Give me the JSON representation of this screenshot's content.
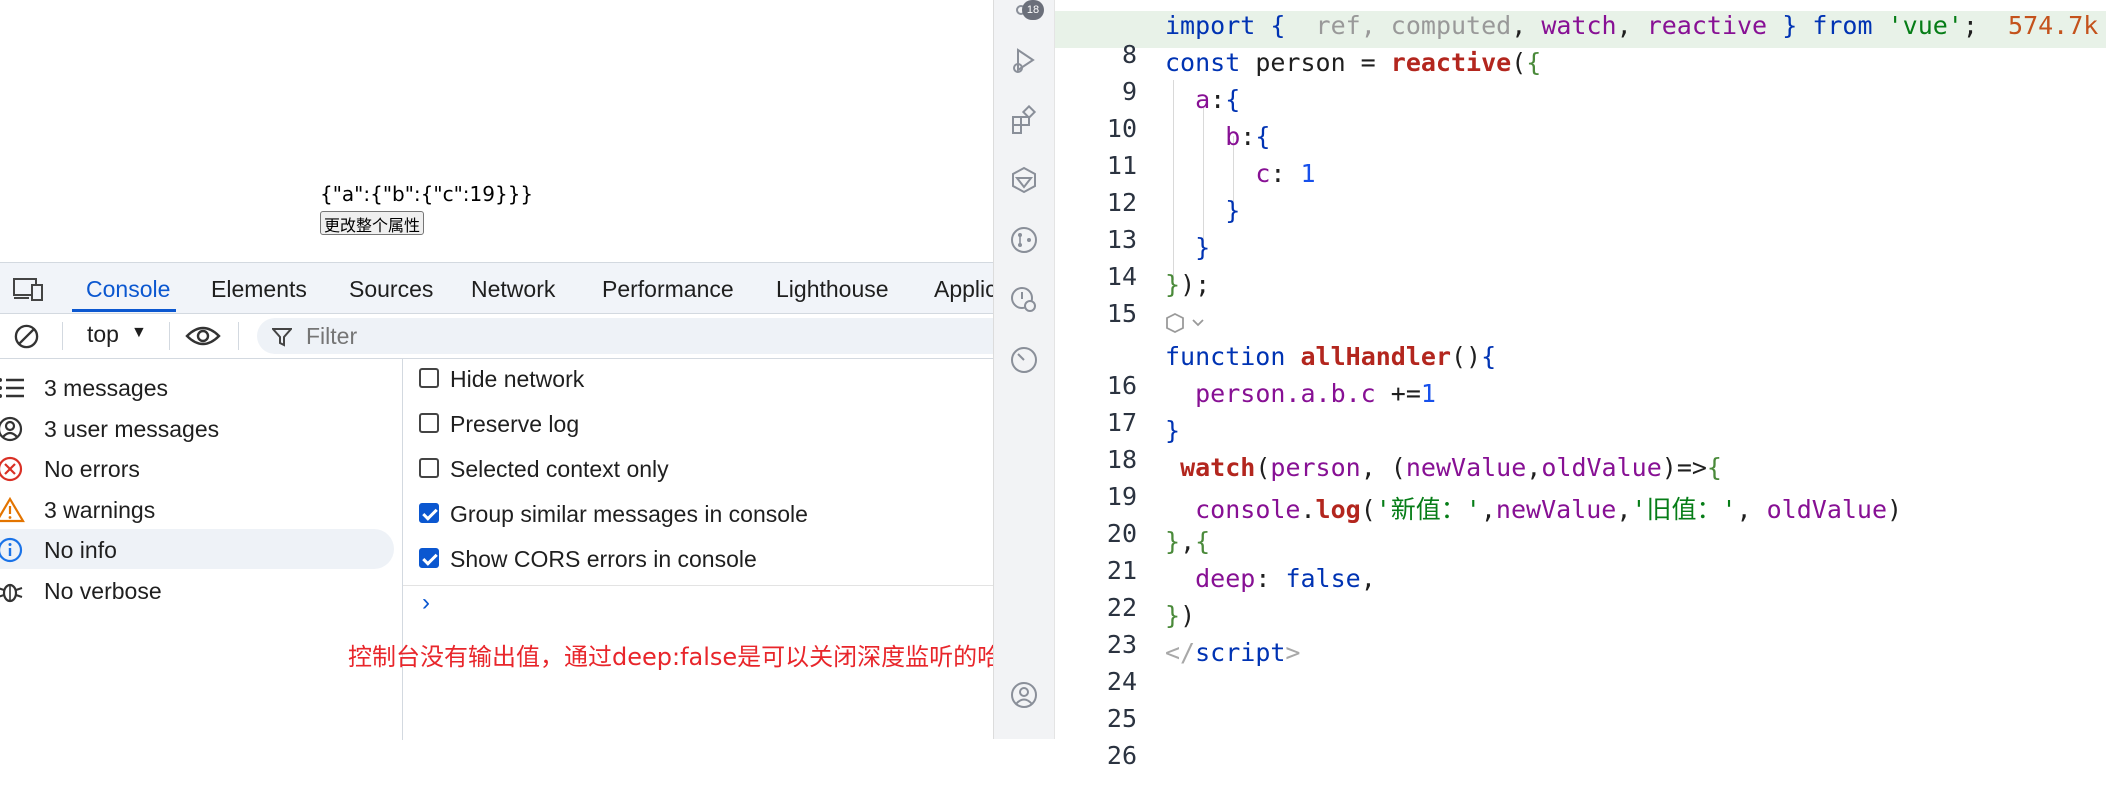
{
  "page": {
    "json_output": "{\"a\":{\"b\":{\"c\":19}}}",
    "button_label": "更改整个属性"
  },
  "devtools": {
    "tabs": [
      "Console",
      "Elements",
      "Sources",
      "Network",
      "Performance",
      "Lighthouse",
      "Applic"
    ],
    "active_tab": "Console",
    "context": "top",
    "filter_placeholder": "Filter",
    "sidebar": [
      {
        "label": "3 messages",
        "icon": "list-icon"
      },
      {
        "label": "3 user messages",
        "icon": "user-icon"
      },
      {
        "label": "No errors",
        "icon": "error-icon"
      },
      {
        "label": "3 warnings",
        "icon": "warning-icon"
      },
      {
        "label": "No info",
        "icon": "info-icon",
        "selected": true
      },
      {
        "label": "No verbose",
        "icon": "bug-icon"
      }
    ],
    "settings": [
      {
        "label": "Hide network",
        "checked": false
      },
      {
        "label": "Preserve log",
        "checked": false
      },
      {
        "label": "Selected context only",
        "checked": false
      },
      {
        "label": "Group similar messages in console",
        "checked": true
      },
      {
        "label": "Show CORS errors in console",
        "checked": true
      }
    ],
    "prompt": "›"
  },
  "annotation": "控制台没有输出值，通过deep:false是可以关闭深度监听的哈",
  "ide": {
    "badge": "18",
    "import_size": "574.7k",
    "line_numbers": [
      "8",
      "9",
      "10",
      "11",
      "12",
      "13",
      "14",
      "15",
      "16",
      "17",
      "18",
      "19",
      "20",
      "21",
      "22",
      "23",
      "24",
      "25",
      "26"
    ],
    "colors": {
      "keyword": "#0033b3",
      "function": "#b3261e",
      "string": "#067d17",
      "property": "#871094"
    }
  }
}
